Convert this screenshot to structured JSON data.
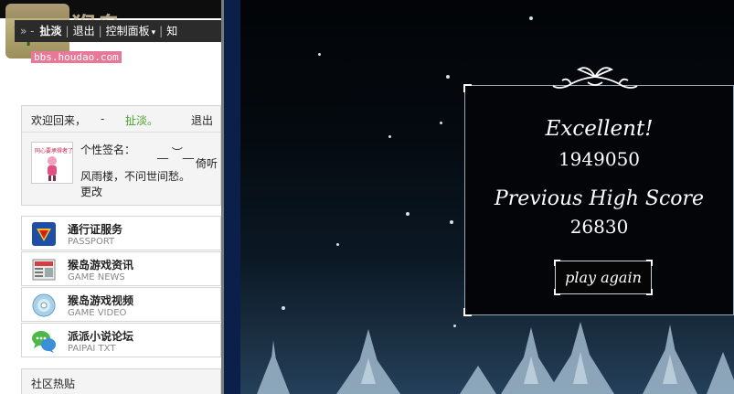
{
  "header": {
    "brand": "猴岛",
    "url_badge": "bbs.houdao.com",
    "nav": {
      "arrows": "» -",
      "username": "扯淡",
      "logout": "退出",
      "control_panel": "控制面板",
      "control_caret": "▾",
      "more": "知"
    }
  },
  "welcome": {
    "greeting": "欢迎回来，",
    "dash": "-",
    "username": "扯淡。",
    "logout": "退出",
    "signature_label": "个性签名：",
    "signature_marks": "__ ︶__",
    "signature_side": "倚听",
    "signature_text": "风雨楼，不问世间愁。",
    "edit": "更改",
    "avatar_tag": "同心要承得者了"
  },
  "services": [
    {
      "title": "通行证服务",
      "subtitle": "PASSPORT",
      "icon": "superman-icon"
    },
    {
      "title": "猴岛游戏资讯",
      "subtitle": "GAME NEWS",
      "icon": "newspaper-icon"
    },
    {
      "title": "猴岛游戏视频",
      "subtitle": "GAME VIDEO",
      "icon": "disc-icon"
    },
    {
      "title": "派派小说论坛",
      "subtitle": "PAIPAI TXT",
      "icon": "chat-bubbles-icon"
    }
  ],
  "community": {
    "title": "社区热贴"
  },
  "game": {
    "result_label": "Excellent!",
    "score": "1949050",
    "high_label": "Previous High Score",
    "high_score": "26830",
    "play_again": "play again"
  },
  "colors": {
    "username_green": "#44a224",
    "url_badge_pink": "#e87898",
    "game_bg": "#020407",
    "divider_blue": "#0a1f4a"
  }
}
